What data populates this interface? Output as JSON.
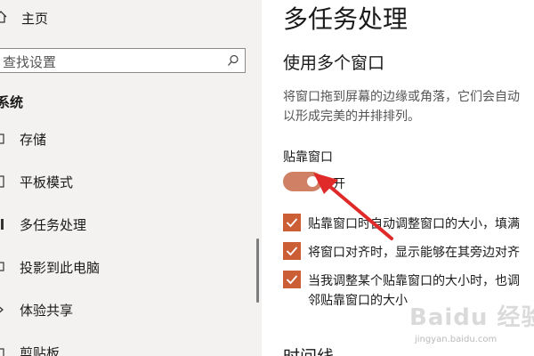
{
  "sidebar": {
    "home_label": "主页",
    "search_placeholder": "查找设置",
    "section_title": "系统",
    "items": [
      {
        "label": "存储",
        "icon": "storage-icon"
      },
      {
        "label": "平板模式",
        "icon": "tablet-mode-icon"
      },
      {
        "label": "多任务处理",
        "icon": "multitasking-icon"
      },
      {
        "label": "投影到此电脑",
        "icon": "projecting-icon"
      },
      {
        "label": "体验共享",
        "icon": "shared-experiences-icon"
      },
      {
        "label": "剪贴板",
        "icon": "clipboard-icon"
      }
    ]
  },
  "main": {
    "title": "多任务处理",
    "subtitle": "使用多个窗口",
    "description_lines": [
      "将窗口拖到屏幕的边缘或角落，它们会自动",
      "以形成完美的并排排列。"
    ],
    "snap_label": "贴靠窗口",
    "toggle": {
      "on": true,
      "state_text": "开"
    },
    "checkboxes": [
      {
        "checked": true,
        "lines": [
          "贴靠窗口时自动调整窗口的大小，填满"
        ]
      },
      {
        "checked": true,
        "lines": [
          "将窗口对齐时，显示能够在其旁边对齐"
        ]
      },
      {
        "checked": true,
        "lines": [
          "当我调整某个贴靠窗口的大小时，也调",
          "邻贴靠窗口的大小"
        ]
      }
    ],
    "next_section": "时间线"
  },
  "watermark": {
    "brand": "Baidu 经验",
    "url": "jingyan.baidu.com"
  },
  "colors": {
    "accent": "#cc5e36",
    "toggle_on": "#d08064",
    "sidebar_bg": "#f4f2f0",
    "arrow": "#e02a2a"
  }
}
